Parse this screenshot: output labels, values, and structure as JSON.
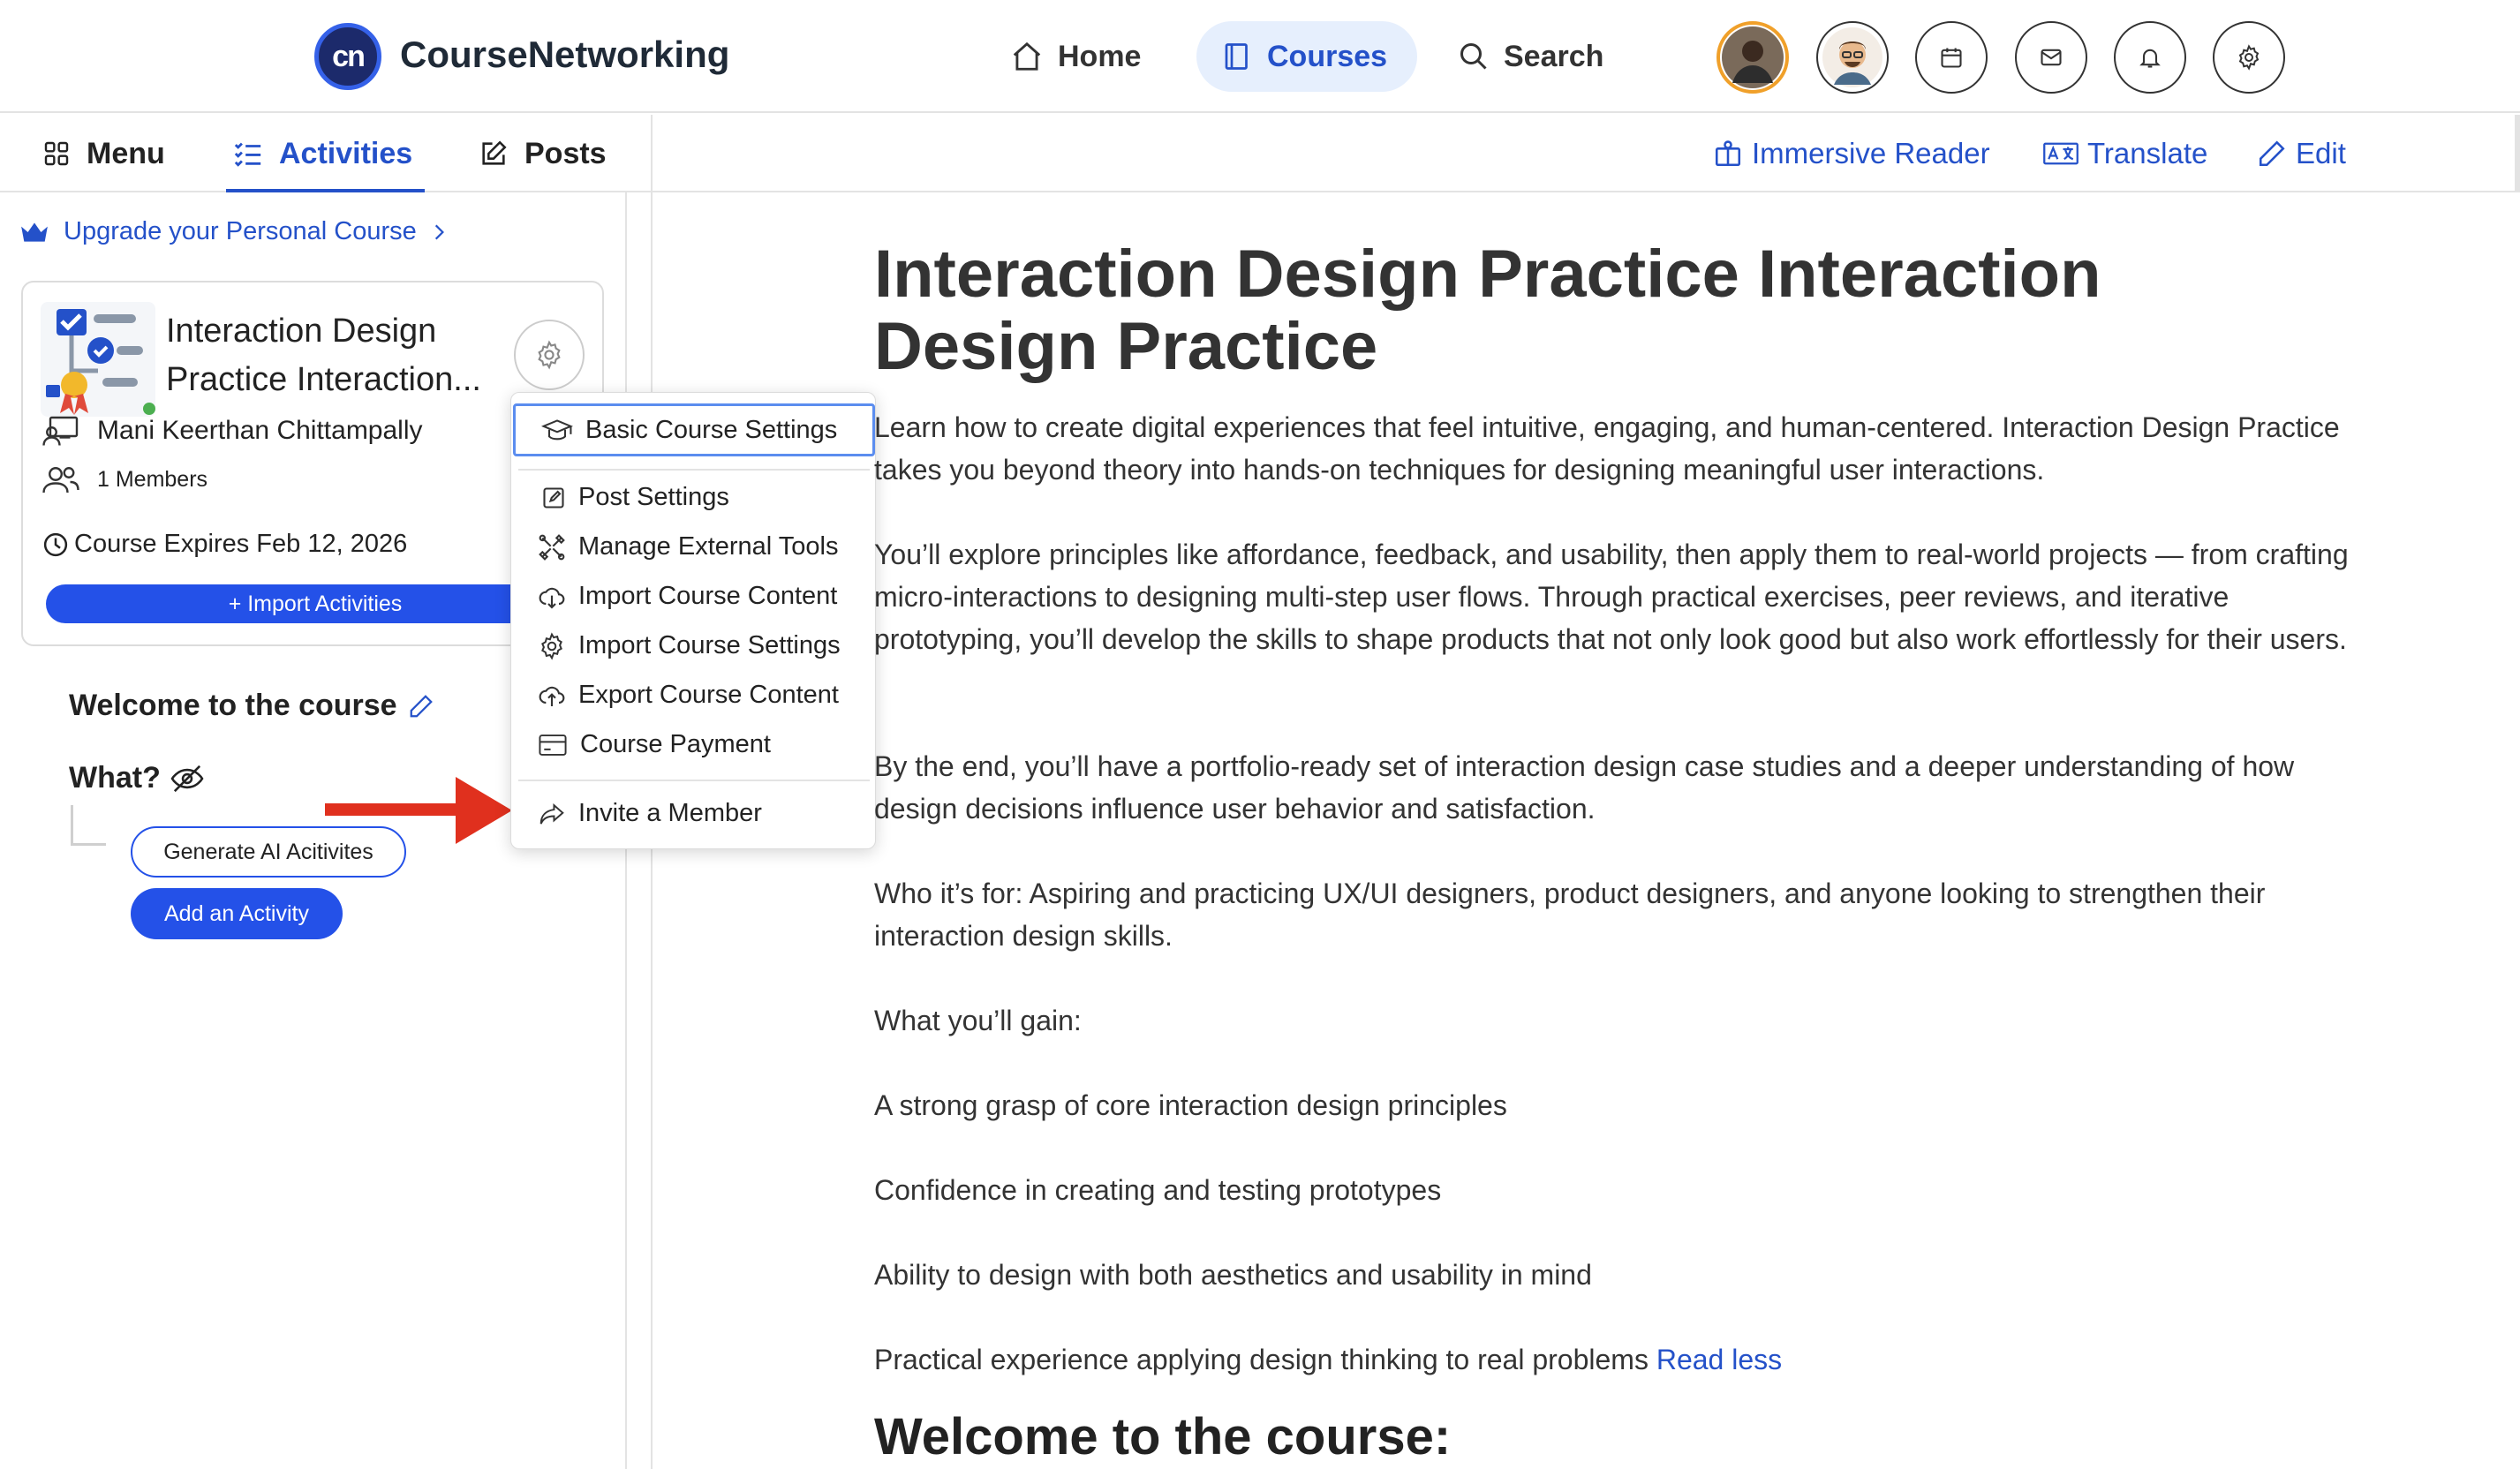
{
  "header": {
    "logo_text": "cn",
    "brand": "CourseNetworking",
    "nav": [
      {
        "label": "Home",
        "icon": "home-icon"
      },
      {
        "label": "Courses",
        "icon": "book-icon",
        "active": true
      },
      {
        "label": "Search",
        "icon": "search-icon"
      }
    ],
    "icons": [
      "avatar",
      "avatar",
      "calendar-icon",
      "mail-icon",
      "bell-icon",
      "gear-icon"
    ]
  },
  "tabs": {
    "menu": "Menu",
    "activities": "Activities",
    "posts": "Posts"
  },
  "tools": {
    "immersive_reader": "Immersive Reader",
    "translate": "Translate",
    "edit": "Edit"
  },
  "sidebar": {
    "upgrade": "Upgrade your Personal Course",
    "course_title": "Interaction Design Practice Interaction...",
    "owner": "Mani Keerthan Chittampally",
    "members": "1 Members",
    "expires": "Course Expires Feb 12, 2026",
    "import_label": "+ Import Activities",
    "welcome": "Welcome to the course",
    "what": "What?",
    "generate_label": "Generate AI Acitivites",
    "add_label": "Add an Activity"
  },
  "dropdown": {
    "items": [
      {
        "label": "Basic Course Settings",
        "icon": "graduation-cap-icon"
      },
      {
        "label": "Post Settings",
        "icon": "edit-square-icon"
      },
      {
        "label": "Manage External Tools",
        "icon": "tools-icon"
      },
      {
        "label": "Import Course Content",
        "icon": "download-icon"
      },
      {
        "label": "Import Course Settings",
        "icon": "gear-icon"
      },
      {
        "label": "Export Course Content",
        "icon": "upload-icon"
      },
      {
        "label": "Course Payment",
        "icon": "credit-card-icon"
      },
      {
        "label": "Invite a Member",
        "icon": "share-icon"
      }
    ]
  },
  "main": {
    "title": "Interaction Design Practice Interaction Design Practice",
    "paragraphs": [
      "Learn how to create digital experiences that feel intuitive, engaging, and human-centered. Interaction Design Practice takes you beyond theory into hands-on techniques for designing meaningful user interactions.",
      "You’ll explore principles like affordance, feedback, and usability, then apply them to real-world projects — from crafting micro-interactions to designing multi-step user flows. Through practical exercises, peer reviews, and iterative prototyping, you’ll develop the skills to shape products that not only look good but also work effortlessly for their users.",
      "By the end, you’ll have a portfolio-ready set of interaction design case studies and a deeper understanding of how design decisions influence user behavior and satisfaction.",
      "Who it’s for: Aspiring and practicing UX/UI designers, product designers, and anyone looking to strengthen their interaction design skills.",
      "What you’ll gain:",
      "A strong grasp of core interaction design principles",
      "Confidence in creating and testing prototypes",
      "Ability to design with both aesthetics and usability in mind",
      "Practical experience applying design thinking to real problems"
    ],
    "read_less": "Read less",
    "subheading": "Welcome to the course:"
  },
  "colors": {
    "accent": "#2451c9",
    "button": "#2451e8",
    "arrow": "#e0301e"
  }
}
